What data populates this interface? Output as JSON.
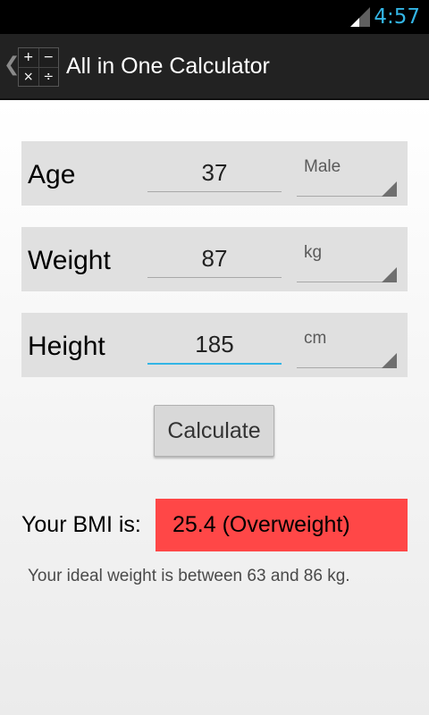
{
  "status_bar": {
    "time": "4:57",
    "signal_icon": "signal-icon",
    "clock_color": "#33b5e5"
  },
  "action_bar": {
    "up_icon": "chevron-left-icon",
    "app_icon": "calculator-icon",
    "app_icon_symbols": [
      "+",
      "−",
      "×",
      "÷"
    ],
    "title": "All in One Calculator"
  },
  "form": {
    "rows": [
      {
        "label": "Age",
        "value": "37",
        "unit": "Male"
      },
      {
        "label": "Weight",
        "value": "87",
        "unit": "kg"
      },
      {
        "label": "Height",
        "value": "185",
        "unit": "cm"
      }
    ],
    "focused_field": "Height",
    "focus_color": "#33b5e5",
    "calculate_label": "Calculate"
  },
  "result": {
    "label": "Your BMI is:",
    "value": "25.4 (Overweight)",
    "value_background": "#ff4747",
    "ideal_weight_text": "Your ideal weight is between 63 and 86 kg."
  }
}
